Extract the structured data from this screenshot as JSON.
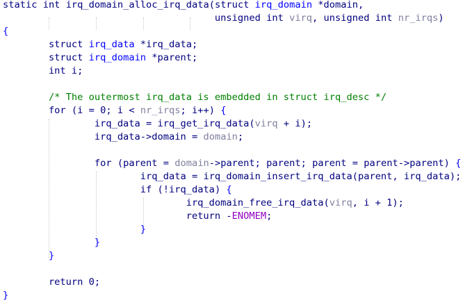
{
  "editor": {
    "language": "C",
    "lines": [
      [
        {
          "t": "static",
          "c": "kw"
        },
        {
          "t": " ",
          "c": "id"
        },
        {
          "t": "int",
          "c": "kw"
        },
        {
          "t": " ",
          "c": "id"
        },
        {
          "t": "irq_domain_alloc_irq_data",
          "c": "fn"
        },
        {
          "t": "(",
          "c": "punc"
        },
        {
          "t": "struct",
          "c": "kw"
        },
        {
          "t": " ",
          "c": "id"
        },
        {
          "t": "irq_domain",
          "c": "type"
        },
        {
          "t": " *",
          "c": "op"
        },
        {
          "t": "domain",
          "c": "id"
        },
        {
          "t": ",",
          "c": "punc"
        }
      ],
      [
        {
          "t": "                                     ",
          "c": "id"
        },
        {
          "t": "unsigned",
          "c": "kw"
        },
        {
          "t": " ",
          "c": "id"
        },
        {
          "t": "int",
          "c": "kw"
        },
        {
          "t": " ",
          "c": "id"
        },
        {
          "t": "virq",
          "c": "param"
        },
        {
          "t": ", ",
          "c": "punc"
        },
        {
          "t": "unsigned",
          "c": "kw"
        },
        {
          "t": " ",
          "c": "id"
        },
        {
          "t": "int",
          "c": "kw"
        },
        {
          "t": " ",
          "c": "id"
        },
        {
          "t": "nr_irqs",
          "c": "param"
        },
        {
          "t": ")",
          "c": "punc"
        }
      ],
      [
        {
          "t": "{",
          "c": "brace"
        }
      ],
      [
        {
          "t": "        ",
          "c": "id"
        },
        {
          "t": "struct",
          "c": "kw"
        },
        {
          "t": " ",
          "c": "id"
        },
        {
          "t": "irq_data",
          "c": "type"
        },
        {
          "t": " *",
          "c": "op"
        },
        {
          "t": "irq_data",
          "c": "id"
        },
        {
          "t": ";",
          "c": "punc"
        }
      ],
      [
        {
          "t": "        ",
          "c": "id"
        },
        {
          "t": "struct",
          "c": "kw"
        },
        {
          "t": " ",
          "c": "id"
        },
        {
          "t": "irq_domain",
          "c": "type"
        },
        {
          "t": " *",
          "c": "op"
        },
        {
          "t": "parent",
          "c": "id"
        },
        {
          "t": ";",
          "c": "punc"
        }
      ],
      [
        {
          "t": "        ",
          "c": "id"
        },
        {
          "t": "int",
          "c": "kw"
        },
        {
          "t": " ",
          "c": "id"
        },
        {
          "t": "i",
          "c": "id"
        },
        {
          "t": ";",
          "c": "punc"
        }
      ],
      [],
      [
        {
          "t": "        ",
          "c": "id"
        },
        {
          "t": "/* The outermost irq_data is embedded in struct irq_desc */",
          "c": "comment"
        }
      ],
      [
        {
          "t": "        ",
          "c": "id"
        },
        {
          "t": "for",
          "c": "kw"
        },
        {
          "t": " (",
          "c": "punc"
        },
        {
          "t": "i",
          "c": "id"
        },
        {
          "t": " = ",
          "c": "op"
        },
        {
          "t": "0",
          "c": "num"
        },
        {
          "t": "; ",
          "c": "punc"
        },
        {
          "t": "i",
          "c": "id"
        },
        {
          "t": " < ",
          "c": "op"
        },
        {
          "t": "nr_irqs",
          "c": "param"
        },
        {
          "t": "; ",
          "c": "punc"
        },
        {
          "t": "i",
          "c": "id"
        },
        {
          "t": "++",
          "c": "op"
        },
        {
          "t": ") ",
          "c": "punc"
        },
        {
          "t": "{",
          "c": "brace"
        }
      ],
      [
        {
          "t": "                ",
          "c": "id"
        },
        {
          "t": "irq_data",
          "c": "id"
        },
        {
          "t": " = ",
          "c": "op"
        },
        {
          "t": "irq_get_irq_data",
          "c": "fn"
        },
        {
          "t": "(",
          "c": "punc"
        },
        {
          "t": "virq",
          "c": "param"
        },
        {
          "t": " + ",
          "c": "op"
        },
        {
          "t": "i",
          "c": "id"
        },
        {
          "t": ");",
          "c": "punc"
        }
      ],
      [
        {
          "t": "                ",
          "c": "id"
        },
        {
          "t": "irq_data",
          "c": "id"
        },
        {
          "t": "->",
          "c": "op"
        },
        {
          "t": "domain",
          "c": "id"
        },
        {
          "t": " = ",
          "c": "op"
        },
        {
          "t": "domain",
          "c": "param"
        },
        {
          "t": ";",
          "c": "punc"
        }
      ],
      [],
      [
        {
          "t": "                ",
          "c": "id"
        },
        {
          "t": "for",
          "c": "kw"
        },
        {
          "t": " (",
          "c": "punc"
        },
        {
          "t": "parent",
          "c": "id"
        },
        {
          "t": " = ",
          "c": "op"
        },
        {
          "t": "domain",
          "c": "param"
        },
        {
          "t": "->",
          "c": "op"
        },
        {
          "t": "parent",
          "c": "id"
        },
        {
          "t": "; ",
          "c": "punc"
        },
        {
          "t": "parent",
          "c": "id"
        },
        {
          "t": "; ",
          "c": "punc"
        },
        {
          "t": "parent",
          "c": "id"
        },
        {
          "t": " = ",
          "c": "op"
        },
        {
          "t": "parent",
          "c": "id"
        },
        {
          "t": "->",
          "c": "op"
        },
        {
          "t": "parent",
          "c": "id"
        },
        {
          "t": ") ",
          "c": "punc"
        },
        {
          "t": "{",
          "c": "brace"
        }
      ],
      [
        {
          "t": "                        ",
          "c": "id"
        },
        {
          "t": "irq_data",
          "c": "id"
        },
        {
          "t": " = ",
          "c": "op"
        },
        {
          "t": "irq_domain_insert_irq_data",
          "c": "fn"
        },
        {
          "t": "(",
          "c": "punc"
        },
        {
          "t": "parent",
          "c": "id"
        },
        {
          "t": ", ",
          "c": "punc"
        },
        {
          "t": "irq_data",
          "c": "id"
        },
        {
          "t": ");",
          "c": "punc"
        }
      ],
      [
        {
          "t": "                        ",
          "c": "id"
        },
        {
          "t": "if",
          "c": "kw"
        },
        {
          "t": " (",
          "c": "punc"
        },
        {
          "t": "!",
          "c": "op"
        },
        {
          "t": "irq_data",
          "c": "id"
        },
        {
          "t": ") ",
          "c": "punc"
        },
        {
          "t": "{",
          "c": "brace"
        }
      ],
      [
        {
          "t": "                                ",
          "c": "id"
        },
        {
          "t": "irq_domain_free_irq_data",
          "c": "fn"
        },
        {
          "t": "(",
          "c": "punc"
        },
        {
          "t": "virq",
          "c": "param"
        },
        {
          "t": ", ",
          "c": "punc"
        },
        {
          "t": "i",
          "c": "id"
        },
        {
          "t": " + ",
          "c": "op"
        },
        {
          "t": "1",
          "c": "num"
        },
        {
          "t": ");",
          "c": "punc"
        }
      ],
      [
        {
          "t": "                                ",
          "c": "id"
        },
        {
          "t": "return",
          "c": "kw"
        },
        {
          "t": " -",
          "c": "op"
        },
        {
          "t": "ENOMEM",
          "c": "macro"
        },
        {
          "t": ";",
          "c": "punc"
        }
      ],
      [
        {
          "t": "                        ",
          "c": "id"
        },
        {
          "t": "}",
          "c": "brace"
        }
      ],
      [
        {
          "t": "                ",
          "c": "id"
        },
        {
          "t": "}",
          "c": "brace"
        }
      ],
      [
        {
          "t": "        ",
          "c": "id"
        },
        {
          "t": "}",
          "c": "brace"
        }
      ],
      [],
      [
        {
          "t": "        ",
          "c": "id"
        },
        {
          "t": "return",
          "c": "kw"
        },
        {
          "t": " ",
          "c": "id"
        },
        {
          "t": "0",
          "c": "num"
        },
        {
          "t": ";",
          "c": "punc"
        }
      ],
      [
        {
          "t": "}",
          "c": "brace"
        }
      ]
    ]
  }
}
